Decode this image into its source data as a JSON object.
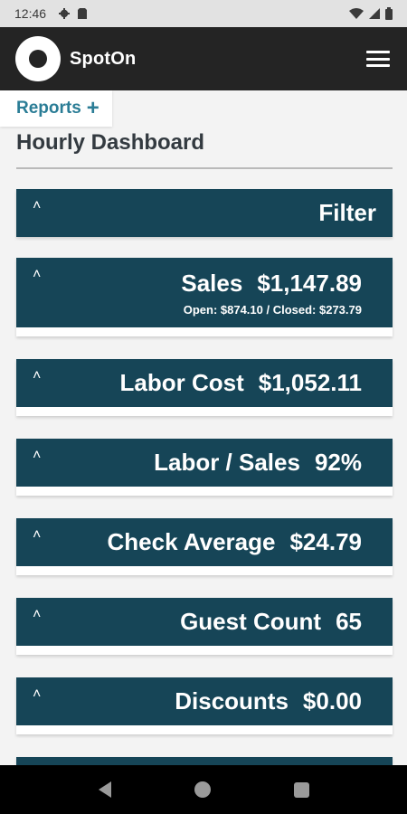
{
  "status_bar": {
    "time": "12:46",
    "icons": [
      "gear-icon",
      "sim-card-icon",
      "wifi-icon",
      "signal-icon",
      "battery-icon"
    ]
  },
  "app_bar": {
    "brand": "SpotOn",
    "menu_icon": "hamburger-menu-icon"
  },
  "reports": {
    "label": "Reports",
    "plus": "+"
  },
  "page": {
    "title": "Hourly Dashboard"
  },
  "cards": {
    "filter": {
      "label": "Filter"
    },
    "sales": {
      "label": "Sales",
      "value": "$1,147.89",
      "sub": "Open: $874.10 / Closed: $273.79"
    },
    "labor_cost": {
      "label": "Labor Cost",
      "value": "$1,052.11"
    },
    "labor_sales": {
      "label": "Labor / Sales",
      "value": "92%"
    },
    "check_average": {
      "label": "Check Average",
      "value": "$24.79"
    },
    "guest_count": {
      "label": "Guest Count",
      "value": "65"
    },
    "discounts": {
      "label": "Discounts",
      "value": "$0.00"
    }
  },
  "caret": "˄",
  "colors": {
    "header": "#242424",
    "card": "#164557",
    "accent": "#2b7d96",
    "background": "#f3f3f3"
  }
}
